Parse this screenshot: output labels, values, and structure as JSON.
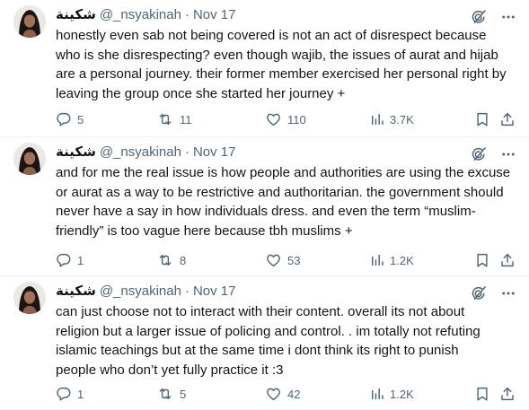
{
  "tweets": [
    {
      "name": "شكينة",
      "handle": "@_nsyakinah",
      "sep": "·",
      "date": "Nov 17",
      "text": "honestly even sab not being covered is not an act of disrespect because\nwho is she disrespecting? even though wajib, the issues of aurat and hijab\nare a personal journey. their former member exercised her personal right by\nleaving the group once she started her journey +",
      "replies": "5",
      "reposts": "11",
      "likes": "110",
      "views": "3.7K"
    },
    {
      "name": "شكينة",
      "handle": "@_nsyakinah",
      "sep": "·",
      "date": "Nov 17",
      "text": "and for me the real issue is how people and authorities are using the excuse\nor aurat as a way to be restrictive and authoritarian. the government should\nnever have a say in how individuals dress. and even the term “muslim-\nfriendly” is too vague here because tbh muslims +",
      "replies": "1",
      "reposts": "8",
      "likes": "53",
      "views": "1.2K"
    },
    {
      "name": "شكينة",
      "handle": "@_nsyakinah",
      "sep": "·",
      "date": "Nov 17",
      "text": "can just choose not to interact with their content. overall its not about\nreligion but a larger issue of policing and control. . im totally not refuting\nislamic teachings but at the same time i dont think its right to punish\npeople who don’t yet fully practice it :3",
      "replies": "1",
      "reposts": "5",
      "likes": "42",
      "views": "1.2K"
    }
  ],
  "icons": {
    "grok": "grok-icon",
    "more": "more-icon",
    "reply": "reply-icon",
    "repost": "repost-icon",
    "like": "like-icon",
    "views": "views-icon",
    "bookmark": "bookmark-icon",
    "share": "share-icon"
  },
  "colors": {
    "text": "#0f1419",
    "muted": "#536471",
    "border": "#eff3f4"
  }
}
